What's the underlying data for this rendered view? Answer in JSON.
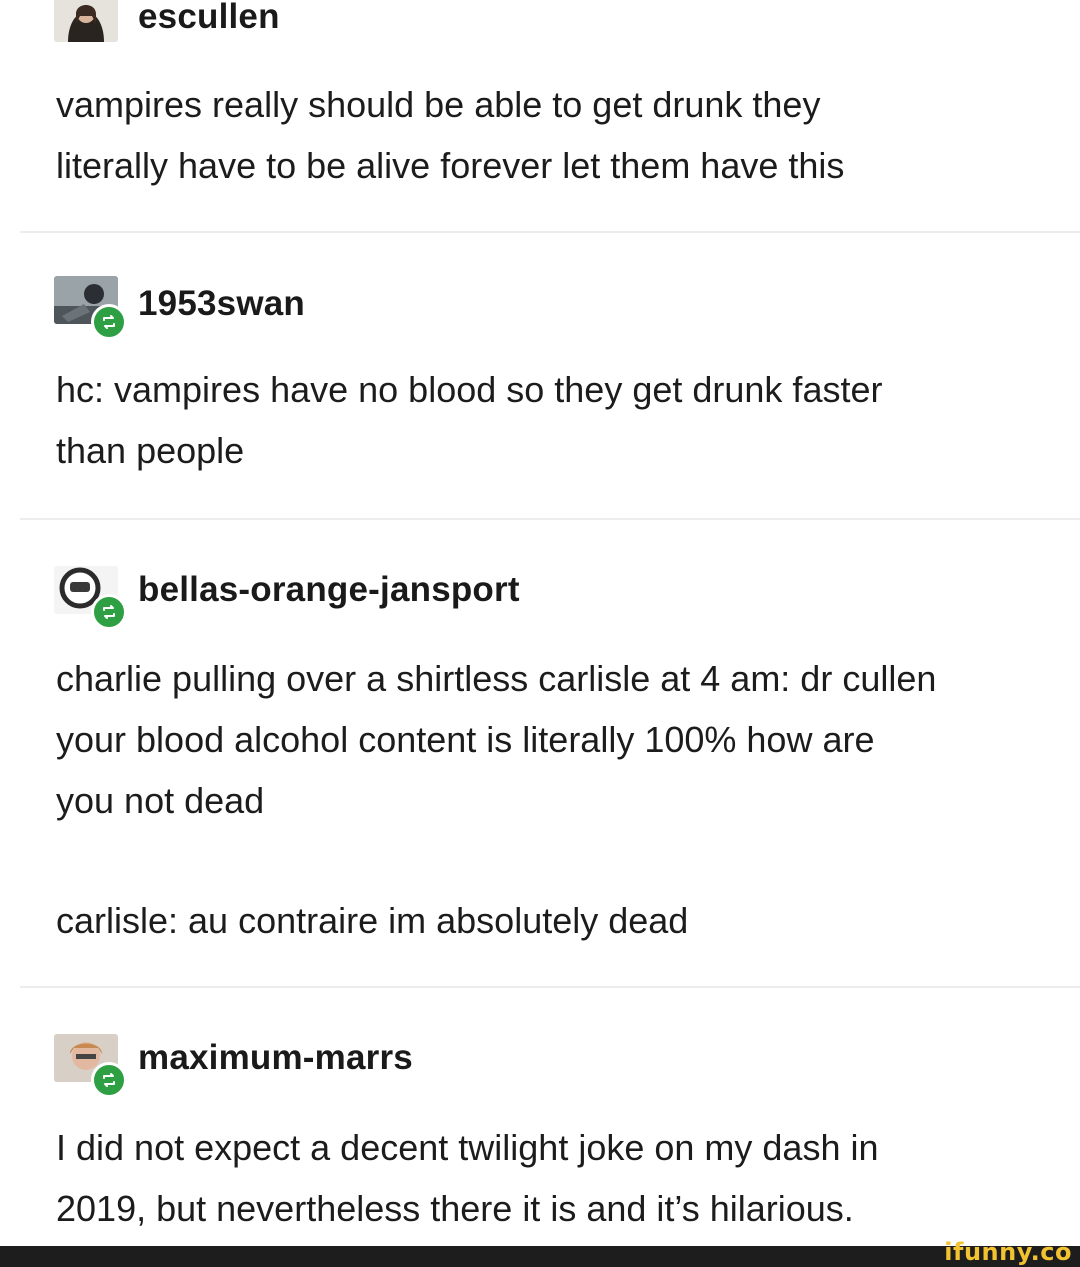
{
  "posts": [
    {
      "username": "escullen",
      "avatar_icon": "user-avatar",
      "reblog": false,
      "text": [
        "vampires really should be able to get drunk they",
        "literally have to be alive forever let them have this"
      ]
    },
    {
      "username": "1953swan",
      "avatar_icon": "user-avatar",
      "reblog": true,
      "text": [
        "hc: vampires have no blood so they get drunk faster",
        "than people"
      ]
    },
    {
      "username": "bellas-orange-jansport",
      "avatar_icon": "user-avatar",
      "reblog": true,
      "text": [
        "charlie pulling over a shirtless carlisle at 4 am: dr cullen",
        "your blood alcohol content is literally 100% how are",
        "you not dead"
      ],
      "text2": [
        "carlisle: au contraire im absolutely dead"
      ]
    },
    {
      "username": "maximum-marrs",
      "avatar_icon": "user-avatar",
      "reblog": true,
      "text": [
        "I did not expect a decent twilight joke on my dash in",
        "2019, but nevertheless there it is and it’s hilarious."
      ]
    }
  ],
  "watermark": "ifunny.co",
  "colors": {
    "reblog_badge": "#2ea043",
    "watermark": "#f2c230",
    "divider": "#ededed"
  }
}
